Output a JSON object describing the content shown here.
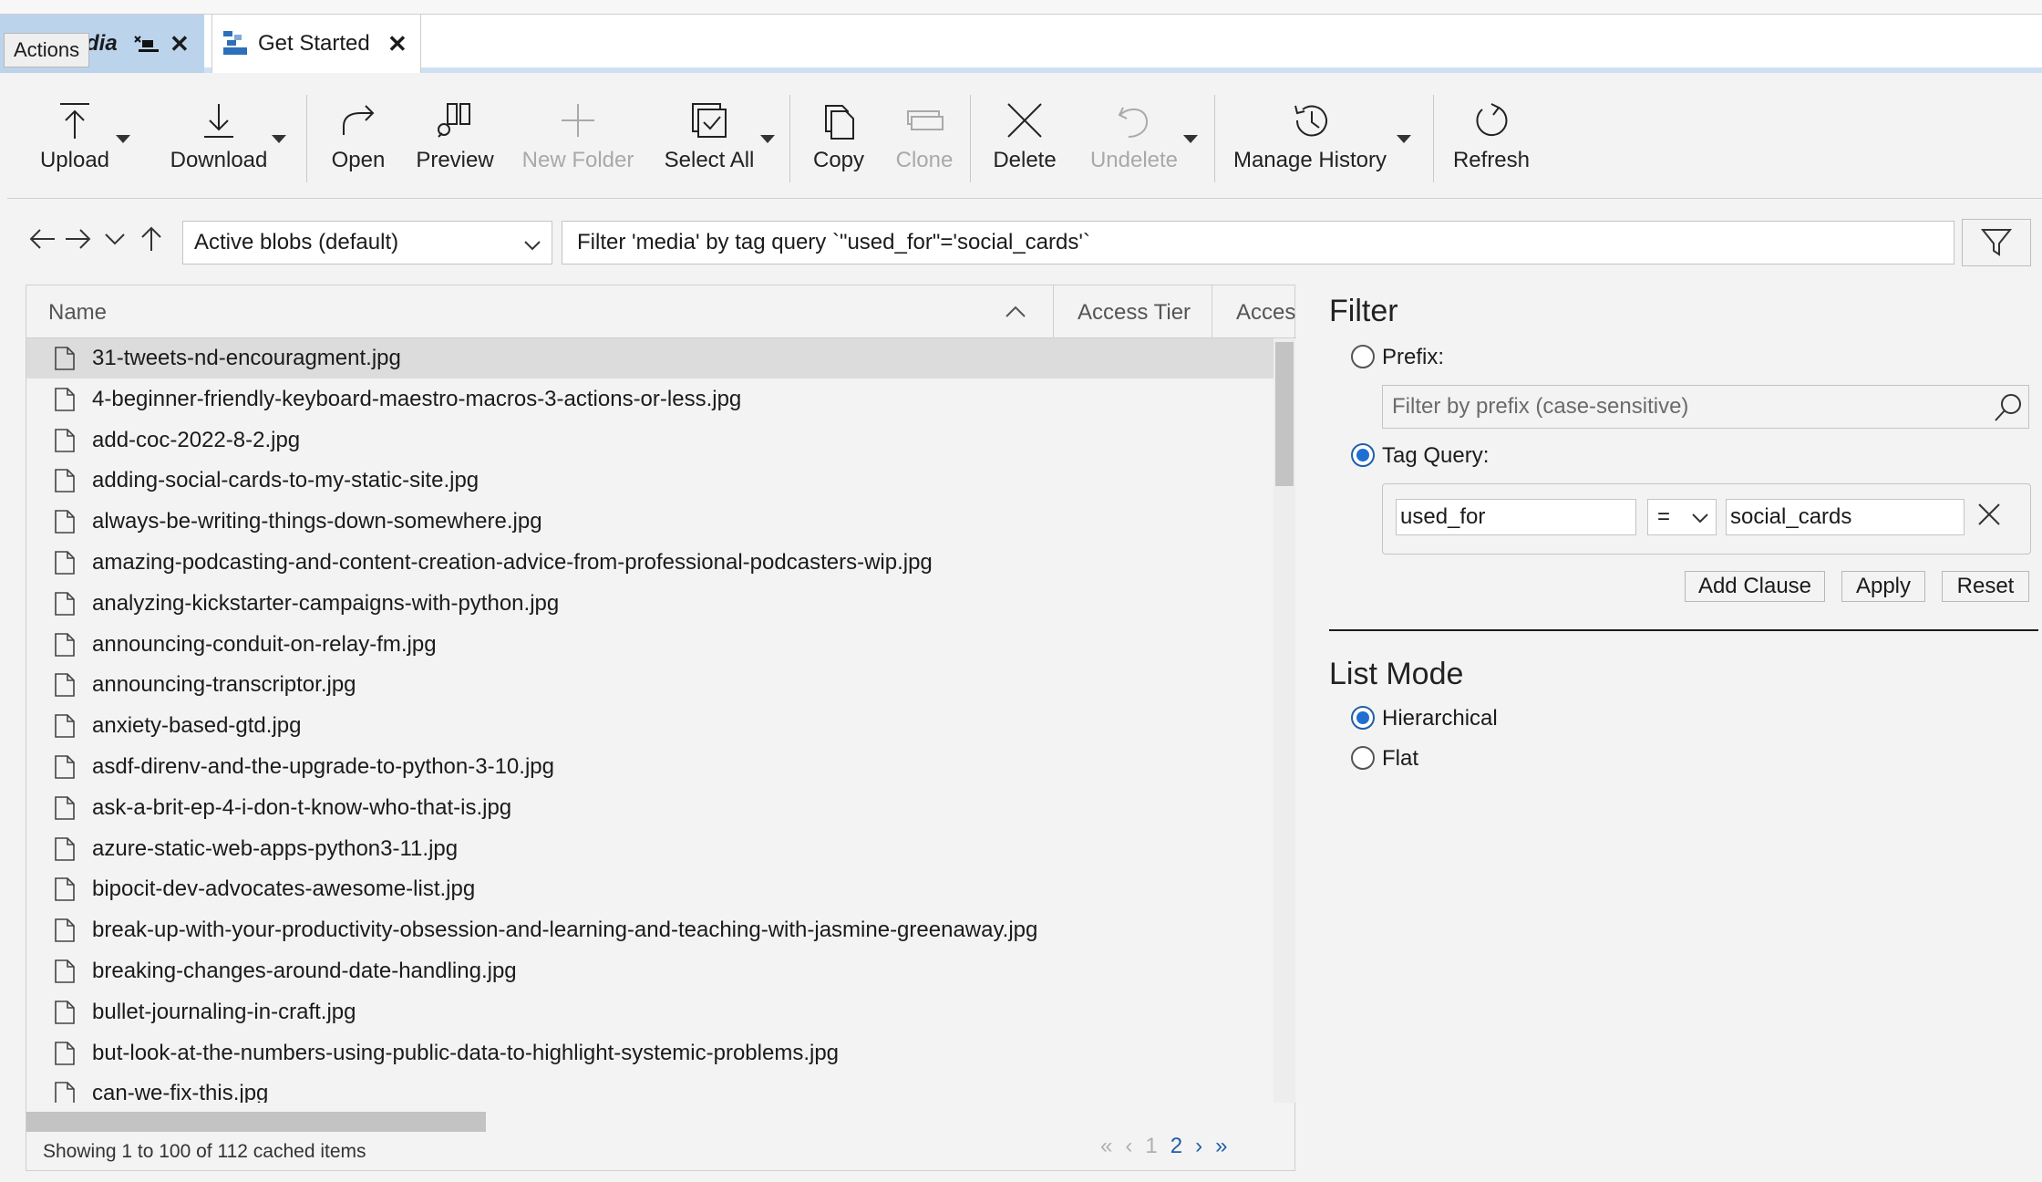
{
  "tabs": {
    "tab1": {
      "label": "dia",
      "tooltip": "Actions"
    },
    "tab2": {
      "label": "Get Started"
    }
  },
  "toolbar": {
    "upload": "Upload",
    "download": "Download",
    "open": "Open",
    "preview": "Preview",
    "new_folder": "New Folder",
    "select_all": "Select All",
    "copy": "Copy",
    "clone": "Clone",
    "delete": "Delete",
    "undelete": "Undelete",
    "manage_history": "Manage History",
    "refresh": "Refresh"
  },
  "nav": {
    "view_select": "Active blobs (default)",
    "filter_text": "Filter 'media' by tag query `\"used_for\"='social_cards'`"
  },
  "list": {
    "columns": [
      "Name",
      "Access Tier",
      "Acces"
    ],
    "rows": [
      "31-tweets-nd-encouragment.jpg",
      "4-beginner-friendly-keyboard-maestro-macros-3-actions-or-less.jpg",
      "add-coc-2022-8-2.jpg",
      "adding-social-cards-to-my-static-site.jpg",
      "always-be-writing-things-down-somewhere.jpg",
      "amazing-podcasting-and-content-creation-advice-from-professional-podcasters-wip.jpg",
      "analyzing-kickstarter-campaigns-with-python.jpg",
      "announcing-conduit-on-relay-fm.jpg",
      "announcing-transcriptor.jpg",
      "anxiety-based-gtd.jpg",
      "asdf-direnv-and-the-upgrade-to-python-3-10.jpg",
      "ask-a-brit-ep-4-i-don-t-know-who-that-is.jpg",
      "azure-static-web-apps-python3-11.jpg",
      "bipocit-dev-advocates-awesome-list.jpg",
      "break-up-with-your-productivity-obsession-and-learning-and-teaching-with-jasmine-greenaway.jpg",
      "breaking-changes-around-date-handling.jpg",
      "bullet-journaling-in-craft.jpg",
      "but-look-at-the-numbers-using-public-data-to-highlight-systemic-problems.jpg",
      "can-we-fix-this.jpg"
    ],
    "status": "Showing 1 to 100 of 112 cached items",
    "pager": {
      "first": "«",
      "prev": "‹",
      "page1": "1",
      "page2": "2",
      "next": "›",
      "last": "»"
    }
  },
  "filter_panel": {
    "title": "Filter",
    "prefix_label": "Prefix:",
    "prefix_placeholder": "Filter by prefix (case-sensitive)",
    "tag_query_label": "Tag Query:",
    "clause_key": "used_for",
    "clause_op": "=",
    "clause_value": "social_cards",
    "add_clause": "Add Clause",
    "apply": "Apply",
    "reset": "Reset",
    "list_mode_title": "List Mode",
    "hierarchical": "Hierarchical",
    "flat": "Flat"
  },
  "colors": {
    "accent": "#1f6fd1",
    "tab_active": "#bcd3ec"
  }
}
